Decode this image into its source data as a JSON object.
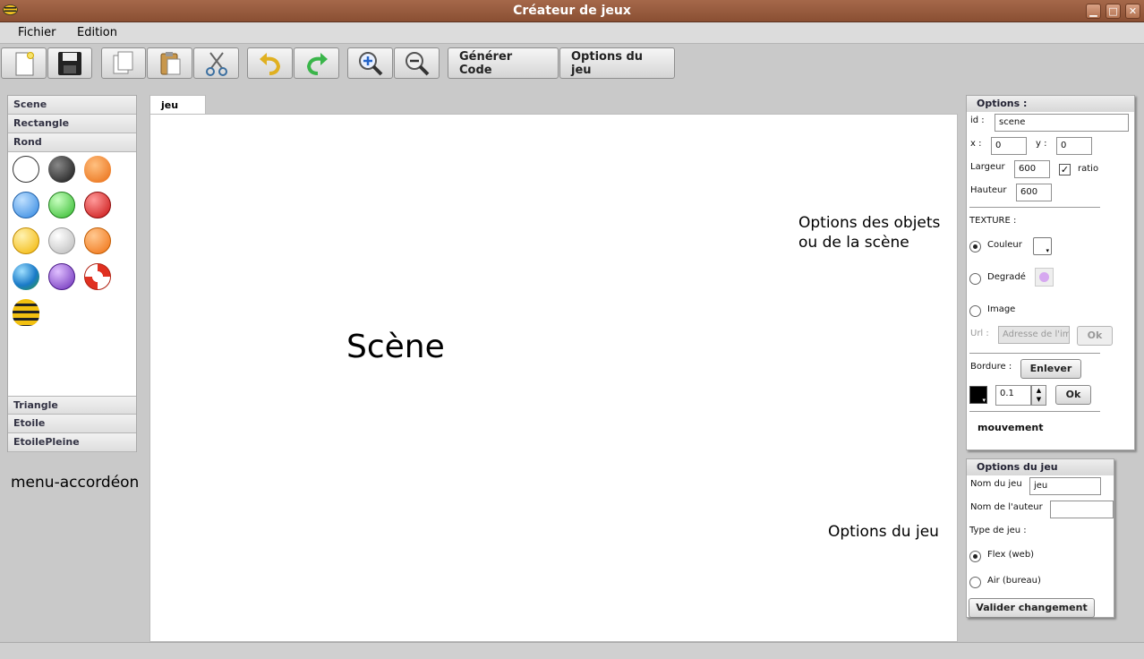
{
  "window": {
    "title": "Créateur de jeux",
    "minimize_glyph": "▁",
    "maximize_glyph": "□",
    "close_glyph": "✕"
  },
  "menu": {
    "fichier": "Fichier",
    "edition": "Edition"
  },
  "toolbar": {
    "icons": [
      "new-file-icon",
      "save-icon",
      "copy-icon",
      "paste-icon",
      "cut-icon",
      "undo-icon",
      "redo-icon",
      "zoom-in-icon",
      "zoom-out-icon"
    ],
    "generate_code": "Générer Code",
    "game_options": "Options du jeu"
  },
  "accordion": {
    "scene": "Scene",
    "rectangle": "Rectangle",
    "rond": "Rond",
    "triangle": "Triangle",
    "etoile": "Etoile",
    "etoile_pleine": "EtoilePleine"
  },
  "annotations": {
    "menu_accordeon": "menu-accordéon",
    "scene": "Scène",
    "options_objets_line1": "Options des objets",
    "options_objets_line2": "ou de la scène",
    "options_jeu": "Options du jeu"
  },
  "tabs": {
    "jeu": "jeu"
  },
  "options": {
    "header": "Options :",
    "id_label": "id :",
    "id_value": "scene",
    "x_label": "x :",
    "x_value": "0",
    "y_label": "y :",
    "y_value": "0",
    "largeur_label": "Largeur",
    "largeur_value": "600",
    "ratio_label": "ratio",
    "ratio_checked": true,
    "hauteur_label": "Hauteur",
    "hauteur_value": "600",
    "texture_label": "TEXTURE :",
    "couleur_label": "Couleur",
    "degrade_label": "Degradé",
    "image_label": "Image",
    "url_label": "Url :",
    "url_placeholder": "Adresse de l'im",
    "ok_label": "Ok",
    "bordure_label": "Bordure :",
    "enlever_label": "Enlever",
    "border_value": "0.1",
    "border_color": "#000000",
    "gradient_color": "#d6a8f0",
    "mouvement_label": "mouvement"
  },
  "game_options": {
    "header": "Options du jeu",
    "nom_label": "Nom du jeu",
    "nom_value": "jeu",
    "auteur_label": "Nom de l'auteur",
    "auteur_value": "",
    "type_label": "Type de jeu :",
    "flex_label": "Flex (web)",
    "air_label": "Air (bureau)",
    "valider_label": "Valider changement"
  }
}
